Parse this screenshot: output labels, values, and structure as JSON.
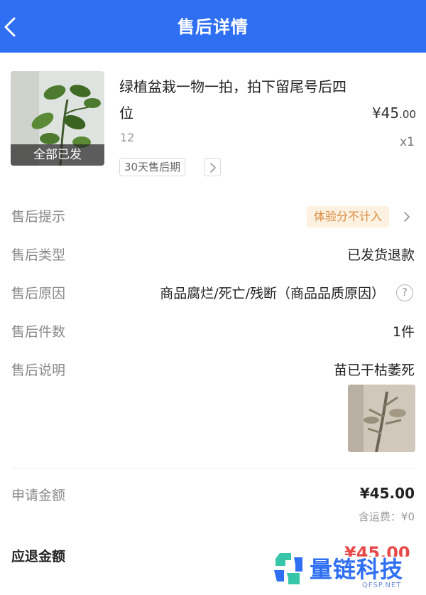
{
  "header": {
    "title": "售后详情"
  },
  "product": {
    "title": "绿植盆栽一物一拍，拍下留尾号后四位",
    "image_label": "全部已发",
    "price_main": "¥45",
    "price_decimal": ".00",
    "spec": "12",
    "quantity": "x1",
    "tag": "30天售后期"
  },
  "details": {
    "tip_label": "售后提示",
    "tip_badge": "体验分不计入",
    "type_label": "售后类型",
    "type_value": "已发货退款",
    "reason_label": "售后原因",
    "reason_value": "商品腐烂/死亡/残断（商品品质原因）",
    "count_label": "售后件数",
    "count_value": "1件",
    "desc_label": "售后说明",
    "desc_value": "苗已干枯萎死"
  },
  "amounts": {
    "apply_label": "申请金额",
    "apply_value": "¥45.00",
    "shipping_note": "含运费：¥0",
    "refund_label": "应退金额",
    "refund_value": "¥45.00"
  },
  "watermark": {
    "name": "量链科技",
    "site": "QFSP.NET"
  },
  "colors": {
    "header": "#2f6ff2",
    "badge_text": "#d98a3a",
    "badge_bg": "#fdf1e2",
    "refund": "#e74a4a"
  },
  "icons": {
    "back": "chevron-left-icon",
    "arrow": "chevron-right-icon",
    "help": "question-circle-icon"
  }
}
